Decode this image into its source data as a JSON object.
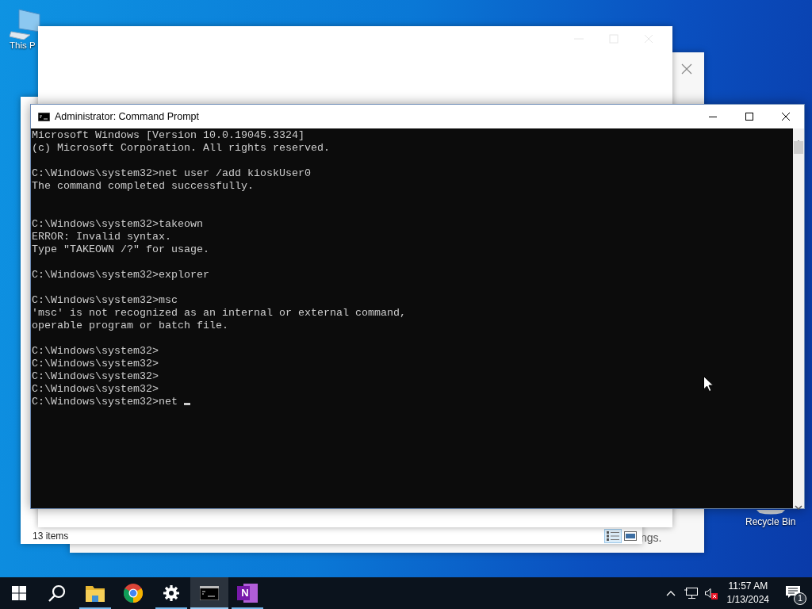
{
  "desktop_icons": [
    {
      "kind": "computer",
      "label": "This P"
    },
    {
      "kind": "recycle",
      "label": "Recycle Bin"
    }
  ],
  "back_window": {
    "text": "ngs."
  },
  "explorer": {
    "status": "13 items",
    "views": [
      {
        "kind": "details",
        "selected": true
      },
      {
        "kind": "tiles",
        "selected": false
      }
    ]
  },
  "console": {
    "title": "Administrator: Command Prompt",
    "cursor": true,
    "lines": [
      {
        "kind": "text",
        "text": "Microsoft Windows [Version 10.0.19045.3324]"
      },
      {
        "kind": "text",
        "text": "(c) Microsoft Corporation. All rights reserved."
      },
      {
        "kind": "blank"
      },
      {
        "kind": "text",
        "text": "C:\\Windows\\system32>net user /add kioskUser0"
      },
      {
        "kind": "text",
        "text": "The command completed successfully."
      },
      {
        "kind": "blank"
      },
      {
        "kind": "blank"
      },
      {
        "kind": "text",
        "text": "C:\\Windows\\system32>takeown"
      },
      {
        "kind": "text",
        "text": "ERROR: Invalid syntax."
      },
      {
        "kind": "text",
        "text": "Type \"TAKEOWN /?\" for usage."
      },
      {
        "kind": "blank"
      },
      {
        "kind": "text",
        "text": "C:\\Windows\\system32>explorer"
      },
      {
        "kind": "blank"
      },
      {
        "kind": "text",
        "text": "C:\\Windows\\system32>msc"
      },
      {
        "kind": "text",
        "text": "'msc' is not recognized as an internal or external command,"
      },
      {
        "kind": "text",
        "text": "operable program or batch file."
      },
      {
        "kind": "blank"
      },
      {
        "kind": "text",
        "text": "C:\\Windows\\system32>"
      },
      {
        "kind": "text",
        "text": "C:\\Windows\\system32>"
      },
      {
        "kind": "text",
        "text": "C:\\Windows\\system32>"
      },
      {
        "kind": "text",
        "text": "C:\\Windows\\system32>"
      },
      {
        "kind": "text",
        "text": "C:\\Windows\\system32>net "
      }
    ]
  },
  "taskbar": {
    "apps": [
      {
        "kind": "start",
        "running": false,
        "selected": false
      },
      {
        "kind": "search",
        "running": false,
        "selected": false
      },
      {
        "kind": "folder",
        "running": true,
        "selected": false
      },
      {
        "kind": "chrome",
        "running": false,
        "selected": false
      },
      {
        "kind": "settings",
        "running": true,
        "selected": false
      },
      {
        "kind": "terminal",
        "running": true,
        "selected": true
      },
      {
        "kind": "notebook",
        "label": "N",
        "running": true,
        "selected": false
      }
    ],
    "tray": {
      "volume_muted": true,
      "time": "11:57 AM",
      "date": "1/13/2024",
      "notifications": "1"
    }
  }
}
